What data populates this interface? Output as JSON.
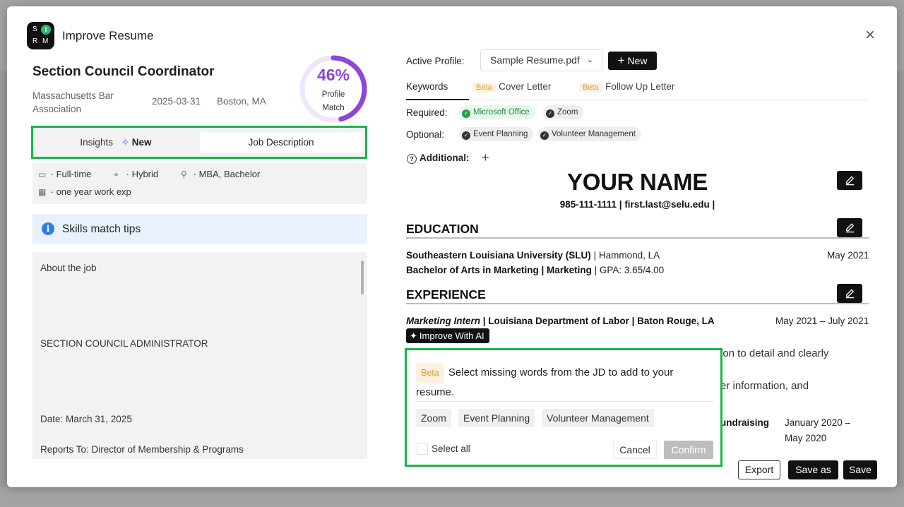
{
  "modal": {
    "logo_letters": [
      "S",
      "I",
      "R",
      "M"
    ],
    "title": "Improve Resume",
    "close_icon": "close-icon"
  },
  "job": {
    "title": "Section Council Coordinator",
    "company": "Massachusetts Bar Association",
    "date": "2025-03-31",
    "location": "Boston, MA",
    "match_percent": "46%",
    "match_fraction": 0.46,
    "match_label_1": "Profile",
    "match_label_2": "Match"
  },
  "tabs": {
    "insights": "Insights",
    "new_badge": "New",
    "job_description": "Job Description"
  },
  "meta": {
    "employment": "Full-time",
    "work_mode": "Hybrid",
    "education": "MBA, Bachelor",
    "experience": "one year work exp"
  },
  "tips": {
    "label": "Skills match tips"
  },
  "job_description": {
    "lines": [
      "About the job",
      "SECTION COUNCIL ADMINISTRATOR",
      "Date: March 31, 2025",
      "Reports To: Director of Membership & Programs"
    ]
  },
  "profile": {
    "label": "Active Profile:",
    "selected": "Sample Resume.pdf",
    "new_button": "New"
  },
  "doc_tabs": {
    "keywords": "Keywords",
    "beta": "Beta",
    "cover_letter": "Cover Letter",
    "follow_up": "Follow Up Letter"
  },
  "keywords": {
    "required_label": "Required:",
    "required": [
      "Microsoft Office",
      "Zoom"
    ],
    "optional_label": "Optional:",
    "optional": [
      "Event Planning",
      "Volunteer Management"
    ],
    "additional_label": "Additional:"
  },
  "resume": {
    "name": "YOUR NAME",
    "contact": "985-111-1111 | first.last@selu.edu |",
    "education_heading": "EDUCATION",
    "school": "Southeastern Louisiana University (SLU)",
    "school_location": " | Hammond, LA",
    "school_date": "May 2021",
    "degree": "Bachelor of Arts in Marketing | Marketing",
    "gpa": " | GPA: 3.65/4.00",
    "experience_heading": "EXPERIENCE",
    "job_role": "Marketing Intern",
    "job_org": " | Louisiana Department of Labor | Baton Rouge, LA",
    "job_date": "May 2021 – July 2021",
    "improve_ai": "Improve With AI",
    "frag1": "ion to detail and clearly",
    "frag2": "er information, and",
    "frag3": "undraising",
    "frag_date1": "January 2020 –",
    "frag_date2": "May 2020"
  },
  "popover": {
    "beta": "Beta",
    "text": "Select missing words from the JD to add to your resume.",
    "words": [
      "Zoom",
      "Event Planning",
      "Volunteer Management"
    ],
    "select_all": "Select all",
    "cancel": "Cancel",
    "confirm": "Confirm"
  },
  "footer": {
    "export": "Export",
    "save_as": "Save as",
    "save": "Save"
  },
  "colors": {
    "accent_purple": "#8d46d8",
    "highlight_green": "#1db34a",
    "beta_orange": "#e49b29",
    "primary_dark": "#111111"
  }
}
